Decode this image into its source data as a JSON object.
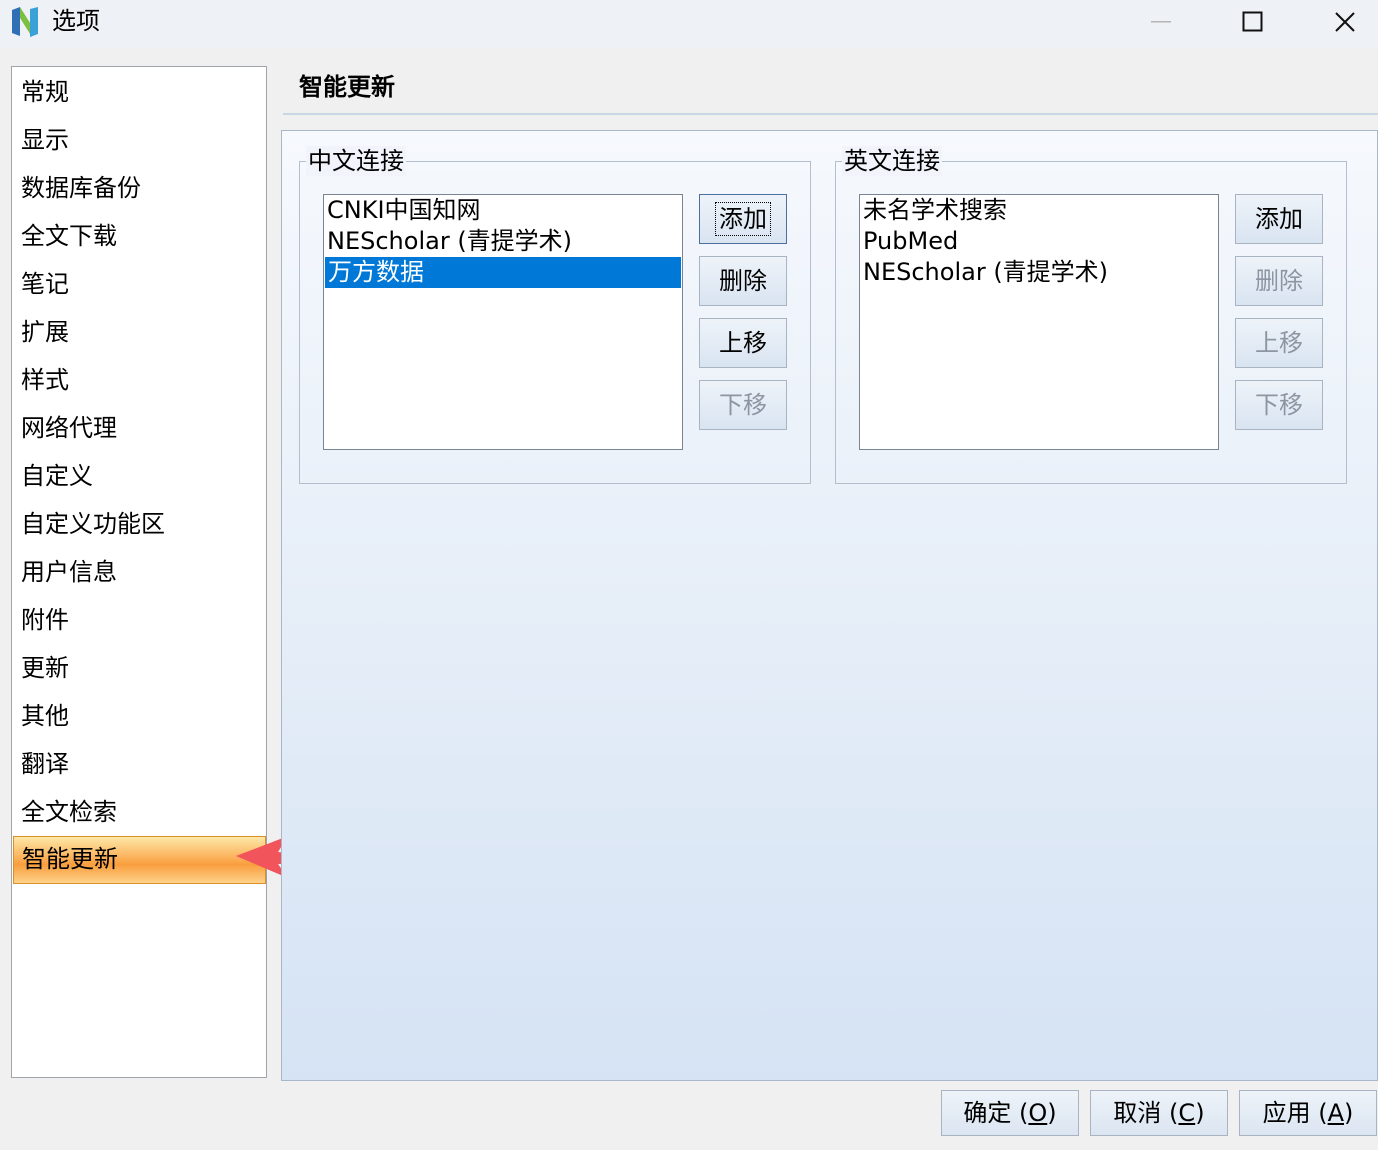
{
  "window": {
    "title": "选项"
  },
  "sidebar": {
    "items": [
      {
        "label": "常规"
      },
      {
        "label": "显示"
      },
      {
        "label": "数据库备份"
      },
      {
        "label": "全文下载"
      },
      {
        "label": "笔记"
      },
      {
        "label": "扩展"
      },
      {
        "label": "样式"
      },
      {
        "label": "网络代理"
      },
      {
        "label": "自定义"
      },
      {
        "label": "自定义功能区"
      },
      {
        "label": "用户信息"
      },
      {
        "label": "附件"
      },
      {
        "label": "更新"
      },
      {
        "label": "其他"
      },
      {
        "label": "翻译"
      },
      {
        "label": "全文检索"
      },
      {
        "label": "智能更新",
        "active": true
      }
    ]
  },
  "main": {
    "title": "智能更新",
    "chinese_links": {
      "label": "中文连接",
      "items": [
        "CNKI中国知网",
        "NEScholar (青提学术)",
        "万方数据"
      ],
      "selected_index": 2,
      "buttons": {
        "add": "添加",
        "delete": "删除",
        "move_up": "上移",
        "move_down": "下移"
      }
    },
    "english_links": {
      "label": "英文连接",
      "items": [
        "未名学术搜索",
        "PubMed",
        "NEScholar (青提学术)"
      ],
      "buttons": {
        "add": "添加",
        "delete": "删除",
        "move_up": "上移",
        "move_down": "下移"
      }
    }
  },
  "footer": {
    "ok": {
      "text": "确定 (",
      "key": "O",
      "close": ")"
    },
    "cancel": {
      "text": "取消 (",
      "key": "C",
      "close": ")"
    },
    "apply": {
      "text": "应用 (",
      "key": "A",
      "close": ")"
    }
  },
  "colors": {
    "selection": "#0078d7",
    "active_nav": "#fcb15a",
    "arrow": "#f2545b"
  }
}
